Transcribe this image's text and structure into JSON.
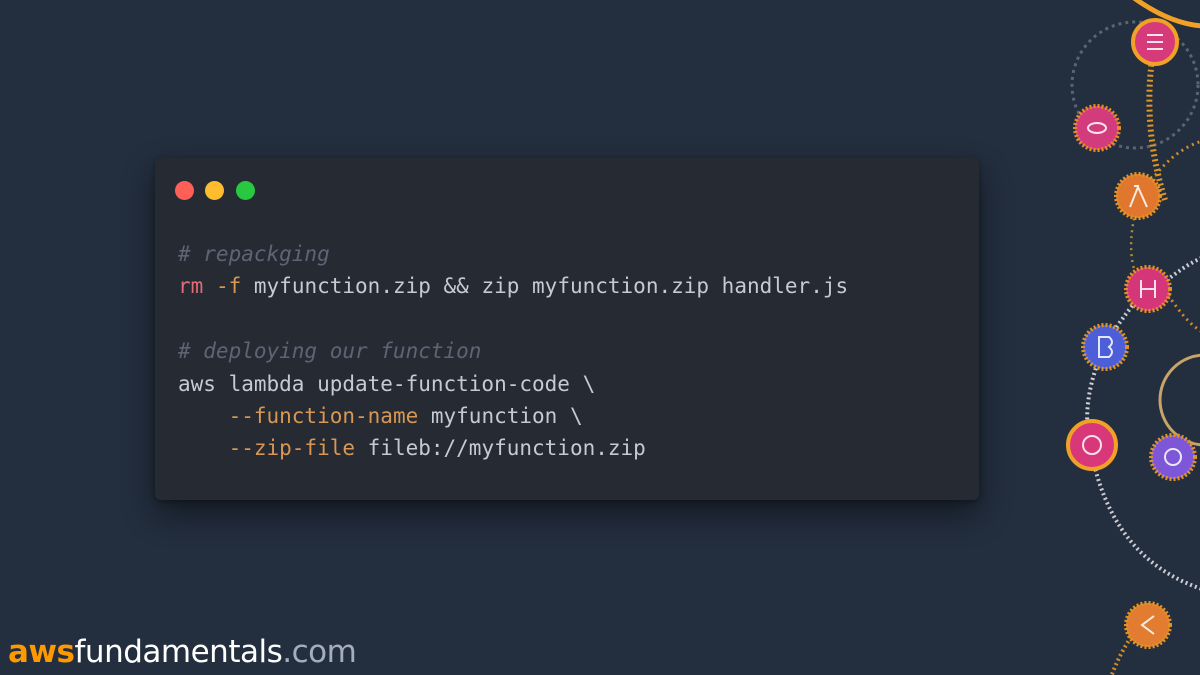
{
  "window": {
    "controls": [
      {
        "name": "close",
        "color": "#fe5f57"
      },
      {
        "name": "minimize",
        "color": "#febc2e"
      },
      {
        "name": "maximize",
        "color": "#28c840"
      }
    ]
  },
  "code": {
    "comment1": "# repackging",
    "rm": "rm",
    "rm_flag": "-f",
    "rm_rest": " myfunction.zip && zip myfunction.zip handler.js",
    "comment2": "# deploying our function",
    "aws_line": "aws lambda update-function-code \\",
    "indent": "    ",
    "flag_function_name": "--function-name",
    "function_name_value": " myfunction \\",
    "flag_zip_file": "--zip-file",
    "zip_file_value": " fileb://myfunction.zip"
  },
  "brand": {
    "aws": "aws",
    "middle": "fundamentals",
    "tld": ".com"
  },
  "colors": {
    "background": "#232e3e",
    "window": "#262a33",
    "comment": "#5d6575",
    "rm": "#e06c75",
    "flag": "#d99754",
    "text": "#c5cad3",
    "brand_accent": "#ff9900"
  },
  "decoration_icons": [
    "aws-service-icon",
    "aws-service-icon",
    "lambda-icon",
    "aws-service-icon",
    "aws-service-icon",
    "aws-service-icon",
    "aws-service-icon",
    "aws-service-icon"
  ]
}
